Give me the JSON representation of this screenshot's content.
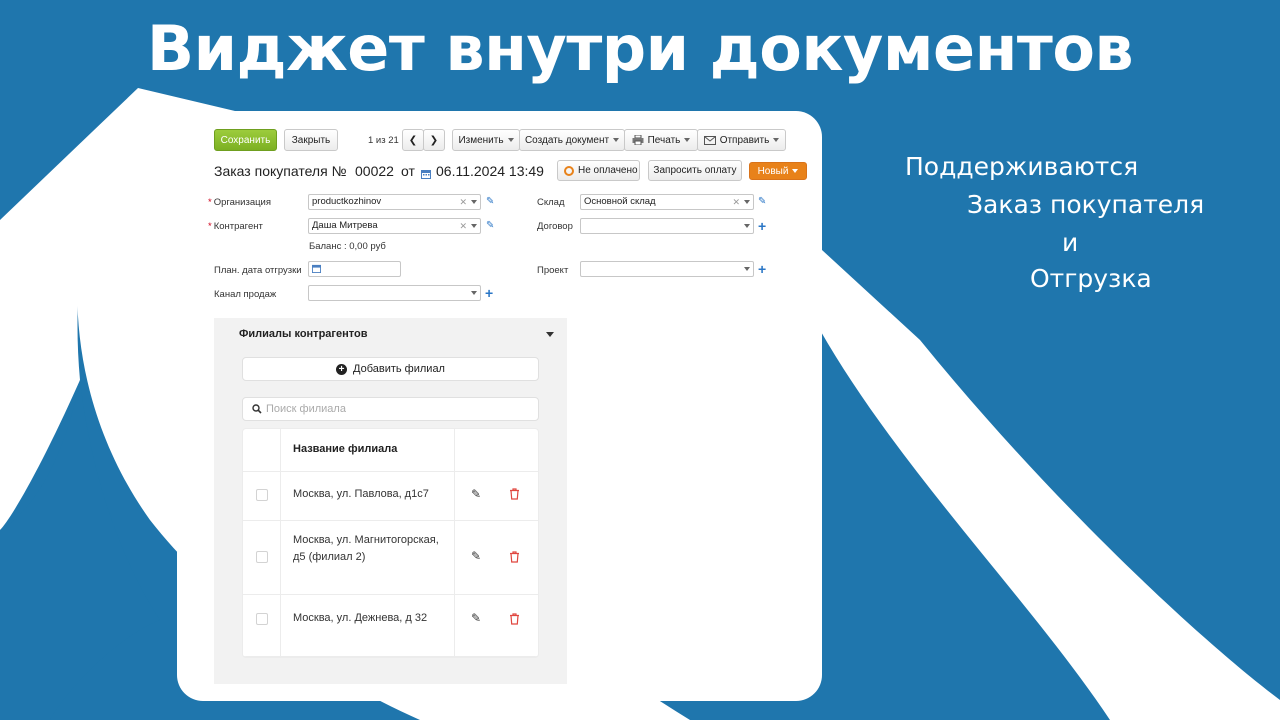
{
  "slide": {
    "headline": "Виджет внутри документов",
    "supported": [
      "Поддерживаются",
      "Заказ покупателя",
      "и",
      "Отгрузка"
    ]
  },
  "toolbar": {
    "save": "Сохранить",
    "close": "Закрыть",
    "pager": "1 из 21",
    "edit": "Изменить",
    "create": "Создать документ",
    "print": "Печать",
    "send": "Отправить"
  },
  "doc": {
    "title": "Заказ покупателя №",
    "number": "00022",
    "from": "от",
    "date": "06.11.2024 13:49",
    "status_paid": "Не оплачено",
    "request_payment": "Запросить оплату",
    "state": "Новый"
  },
  "form": {
    "org_label": "Организация",
    "org_value": "productkozhinov",
    "contractor_label": "Контрагент",
    "contractor_value": "Даша Митрева",
    "balance": "Баланс : 0,00 руб",
    "ship_date_label": "План. дата отгрузки",
    "channel_label": "Канал продаж",
    "warehouse_label": "Склад",
    "warehouse_value": "Основной склад",
    "contract_label": "Договор",
    "project_label": "Проект"
  },
  "widget": {
    "title": "Филиалы контрагентов",
    "add_button": "Добавить филиал",
    "search_placeholder": "Поиск филиала",
    "column_name": "Название филиала",
    "rows": [
      "Москва, ул. Павлова, д1с7",
      "Москва, ул. Магнитогорская, д5 (филиал 2)",
      "Москва, ул. Дежнева, д 32"
    ]
  },
  "colors": {
    "background": "#1f76ad",
    "save_green": "#8cc232",
    "state_orange": "#e8821a",
    "delete_red": "#e0463f"
  }
}
